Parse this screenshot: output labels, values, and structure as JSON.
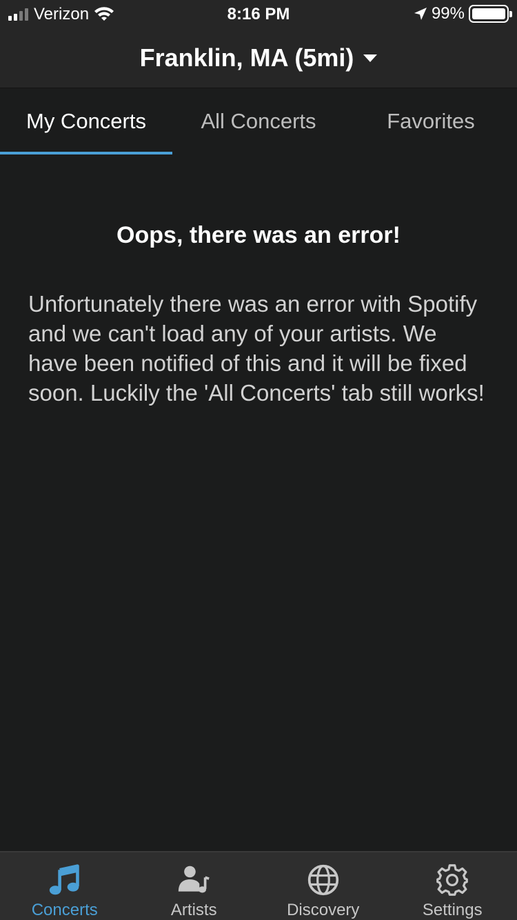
{
  "status_bar": {
    "carrier": "Verizon",
    "time": "8:16 PM",
    "battery": "99%",
    "battery_level": 0.99,
    "signal_bars_filled": 2,
    "signal_bars_total": 4
  },
  "header": {
    "location": "Franklin, MA (5mi)"
  },
  "tabs": [
    {
      "label": "My Concerts",
      "active": true
    },
    {
      "label": "All Concerts",
      "active": false
    },
    {
      "label": "Favorites",
      "active": false
    }
  ],
  "error": {
    "title": "Oops, there was an error!",
    "message": "Unfortunately there was an error with Spotify and we can't load any of your artists. We have been notified of this and it will be fixed soon. Luckily the 'All Concerts' tab still works!"
  },
  "tab_bar": [
    {
      "label": "Concerts",
      "icon": "music-note-icon",
      "active": true
    },
    {
      "label": "Artists",
      "icon": "artist-icon",
      "active": false
    },
    {
      "label": "Discovery",
      "icon": "globe-icon",
      "active": false
    },
    {
      "label": "Settings",
      "icon": "gear-icon",
      "active": false
    }
  ],
  "colors": {
    "accent": "#4a9fd6",
    "background": "#1b1c1c",
    "header": "#262626",
    "tab_bar": "#2e2e2e"
  }
}
